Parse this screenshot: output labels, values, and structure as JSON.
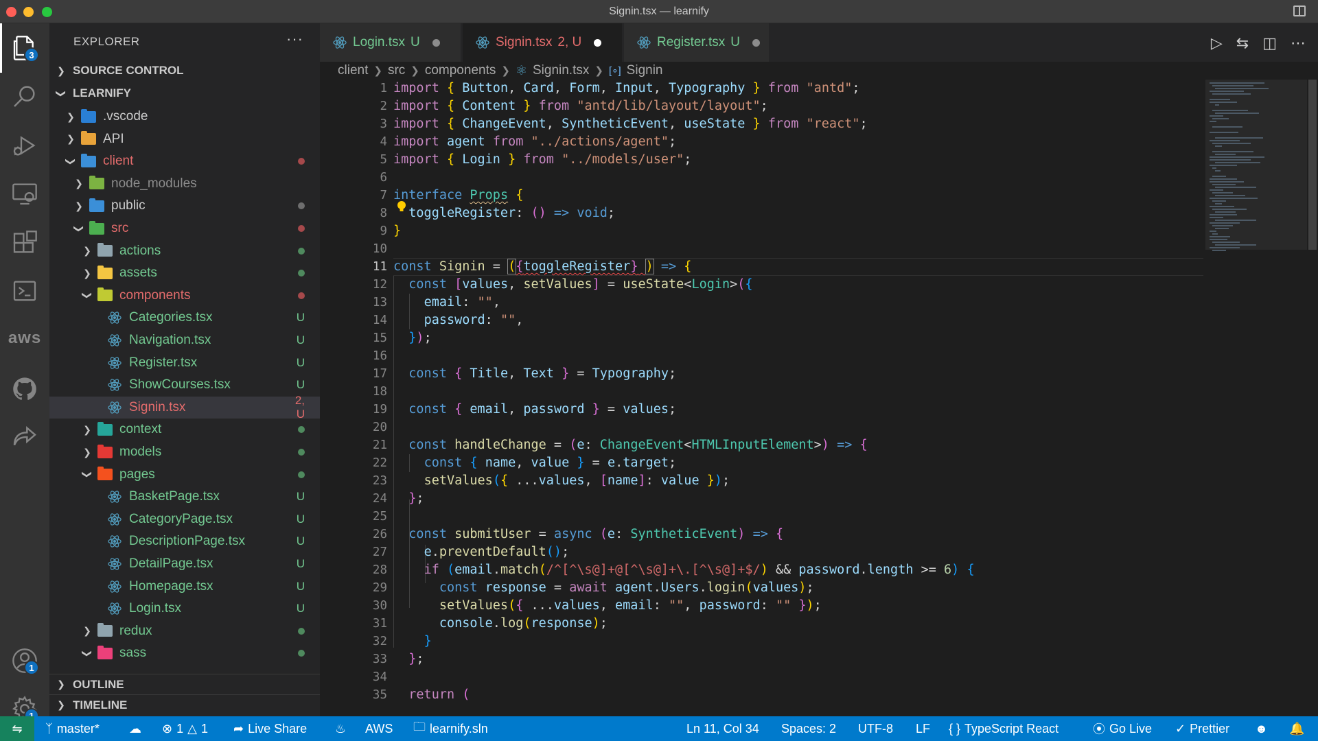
{
  "window": {
    "title": "Signin.tsx — learnify"
  },
  "activity_bar": {
    "explorer_badge": "3",
    "accounts_badge": "1",
    "settings_badge": "1",
    "aws_label": "aws"
  },
  "sidebar": {
    "title": "EXPLORER",
    "more_actions": "···",
    "source_control_label": "SOURCE CONTROL",
    "project_label": "LEARNIFY",
    "outline_label": "OUTLINE",
    "timeline_label": "TIMELINE",
    "tree": [
      {
        "label": ".vscode",
        "type": "folder",
        "expanded": false,
        "depth": 1,
        "color": "#cccccc",
        "icon_color": "#2a7fd4",
        "status": ""
      },
      {
        "label": "API",
        "type": "folder",
        "expanded": false,
        "depth": 1,
        "color": "#cccccc",
        "icon_color": "#e8a33a",
        "status": ""
      },
      {
        "label": "client",
        "type": "folder",
        "expanded": true,
        "depth": 1,
        "color": "#e46c6c",
        "icon_color": "#3b8fd8",
        "status": "dot-red"
      },
      {
        "label": "node_modules",
        "type": "folder",
        "expanded": false,
        "depth": 2,
        "color": "#8c8c8c",
        "icon_color": "#7cb342",
        "status": ""
      },
      {
        "label": "public",
        "type": "folder",
        "expanded": false,
        "depth": 2,
        "color": "#cccccc",
        "icon_color": "#3b8fd8",
        "status": "dot-grey"
      },
      {
        "label": "src",
        "type": "folder",
        "expanded": true,
        "depth": 2,
        "color": "#e46c6c",
        "icon_color": "#4caf50",
        "status": "dot-red"
      },
      {
        "label": "actions",
        "type": "folder",
        "expanded": false,
        "depth": 3,
        "color": "#73c991",
        "icon_color": "#90a4ae",
        "status": "dot-green"
      },
      {
        "label": "assets",
        "type": "folder",
        "expanded": false,
        "depth": 3,
        "color": "#73c991",
        "icon_color": "#f4c542",
        "status": "dot-green"
      },
      {
        "label": "components",
        "type": "folder",
        "expanded": true,
        "depth": 3,
        "color": "#e46c6c",
        "icon_color": "#c0ca33",
        "status": "dot-red"
      },
      {
        "label": "Categories.tsx",
        "type": "file",
        "depth": 4,
        "color": "#73c991",
        "status": "U"
      },
      {
        "label": "Navigation.tsx",
        "type": "file",
        "depth": 4,
        "color": "#73c991",
        "status": "U"
      },
      {
        "label": "Register.tsx",
        "type": "file",
        "depth": 4,
        "color": "#73c991",
        "status": "U"
      },
      {
        "label": "ShowCourses.tsx",
        "type": "file",
        "depth": 4,
        "color": "#73c991",
        "status": "U"
      },
      {
        "label": "Signin.tsx",
        "type": "file",
        "depth": 4,
        "color": "#e46c6c",
        "status": "2, U",
        "selected": true
      },
      {
        "label": "context",
        "type": "folder",
        "expanded": false,
        "depth": 3,
        "color": "#73c991",
        "icon_color": "#26a69a",
        "status": "dot-green"
      },
      {
        "label": "models",
        "type": "folder",
        "expanded": false,
        "depth": 3,
        "color": "#73c991",
        "icon_color": "#e53935",
        "status": "dot-green"
      },
      {
        "label": "pages",
        "type": "folder",
        "expanded": true,
        "depth": 3,
        "color": "#73c991",
        "icon_color": "#f4511e",
        "status": "dot-green"
      },
      {
        "label": "BasketPage.tsx",
        "type": "file",
        "depth": 4,
        "color": "#73c991",
        "status": "U"
      },
      {
        "label": "CategoryPage.tsx",
        "type": "file",
        "depth": 4,
        "color": "#73c991",
        "status": "U"
      },
      {
        "label": "DescriptionPage.tsx",
        "type": "file",
        "depth": 4,
        "color": "#73c991",
        "status": "U"
      },
      {
        "label": "DetailPage.tsx",
        "type": "file",
        "depth": 4,
        "color": "#73c991",
        "status": "U"
      },
      {
        "label": "Homepage.tsx",
        "type": "file",
        "depth": 4,
        "color": "#73c991",
        "status": "U"
      },
      {
        "label": "Login.tsx",
        "type": "file",
        "depth": 4,
        "color": "#73c991",
        "status": "U"
      },
      {
        "label": "redux",
        "type": "folder",
        "expanded": false,
        "depth": 3,
        "color": "#73c991",
        "icon_color": "#90a4ae",
        "status": "dot-green"
      },
      {
        "label": "sass",
        "type": "folder",
        "expanded": true,
        "depth": 3,
        "color": "#73c991",
        "icon_color": "#ec407a",
        "status": "dot-green"
      }
    ]
  },
  "tabs": [
    {
      "name": "Login.tsx",
      "status": "U",
      "color": "#73c991",
      "active": false
    },
    {
      "name": "Signin.tsx",
      "status": "2, U",
      "color": "#e46c6c",
      "active": true
    },
    {
      "name": "Register.tsx",
      "status": "U",
      "color": "#73c991",
      "active": false
    }
  ],
  "breadcrumb": {
    "parts": [
      "client",
      "src",
      "components"
    ],
    "file": "Signin.tsx",
    "symbol": "Signin"
  },
  "editor": {
    "current_line": 11,
    "line_numbers": [
      "1",
      "2",
      "3",
      "4",
      "5",
      "6",
      "7",
      "8",
      "9",
      "10",
      "11",
      "12",
      "13",
      "14",
      "15",
      "16",
      "17",
      "18",
      "19",
      "20",
      "21",
      "22",
      "23",
      "24",
      "25",
      "26",
      "27",
      "28",
      "29",
      "30",
      "31",
      "32",
      "33",
      "34",
      "35"
    ]
  },
  "status_bar": {
    "branch": "master*",
    "errors": "1",
    "warnings": "1",
    "live_share": "Live Share",
    "aws": "AWS",
    "solution": "learnify.sln",
    "cursor_position": "Ln 11, Col 34",
    "spaces": "Spaces: 2",
    "encoding": "UTF-8",
    "eol": "LF",
    "language": "TypeScript React",
    "go_live": "Go Live",
    "prettier": "Prettier"
  }
}
